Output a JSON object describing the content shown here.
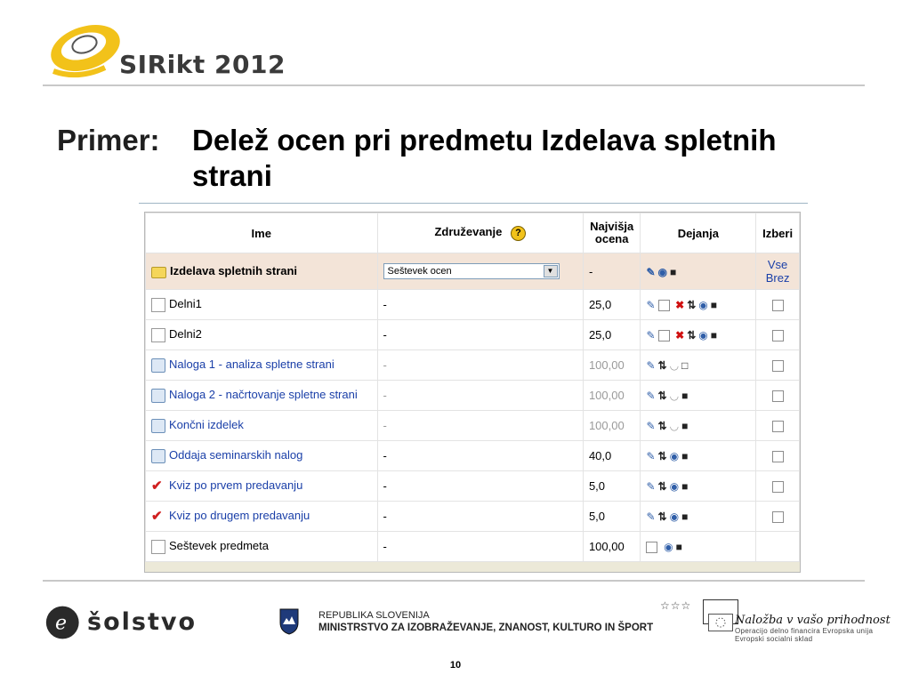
{
  "header": {
    "logo_sir": "SIR",
    "logo_ikt": "ikt",
    "logo_year": " 2012"
  },
  "title": {
    "label": "Primer:",
    "text": "Delež ocen pri predmetu Izdelava spletnih strani"
  },
  "table": {
    "headers": {
      "name": "Ime",
      "aggregation": "Združevanje",
      "max": "Najvišja ocena",
      "actions": "Dejanja",
      "select": "Izberi"
    },
    "course": {
      "name": "Izdelava spletnih strani",
      "aggregation_value": "Seštevek ocen",
      "max": "-",
      "select_all": "Vse",
      "select_none": "Brez"
    },
    "rows": [
      {
        "name": "Delni1",
        "aggregation": "-",
        "max": "25,0"
      },
      {
        "name": "Delni2",
        "aggregation": "-",
        "max": "25,0"
      },
      {
        "name": "Naloga 1 - analiza spletne strani",
        "aggregation": "-",
        "max": "100,00"
      },
      {
        "name": "Naloga 2 - načrtovanje spletne strani",
        "aggregation": "-",
        "max": "100,00"
      },
      {
        "name": "Končni izdelek",
        "aggregation": "-",
        "max": "100,00"
      },
      {
        "name": "Oddaja seminarskih nalog",
        "aggregation": "-",
        "max": "40,0"
      },
      {
        "name": "Kviz po prvem predavanju",
        "aggregation": "-",
        "max": "5,0"
      },
      {
        "name": "Kviz po drugem predavanju",
        "aggregation": "-",
        "max": "5,0"
      },
      {
        "name": "Seštevek predmeta",
        "aggregation": "-",
        "max": "100,00"
      }
    ]
  },
  "footer": {
    "solstvo": "šolstvo",
    "ministry_line1": "REPUBLIKA SLOVENIJA",
    "ministry_line2": "MINISTRSTVO ZA IZOBRAŽEVANJE, ZNANOST, KULTURO IN ŠPORT",
    "eu_slogan": "Naložba v vašo prihodnost",
    "eu_line1": "Operacijo delno financira Evropska unija",
    "eu_line2": "Evropski socialni sklad",
    "page_number": "10"
  },
  "colors": {
    "course_row_bg": "#f3e4d8",
    "link": "#1a3fa8",
    "logo_yellow": "#f2c21a"
  }
}
